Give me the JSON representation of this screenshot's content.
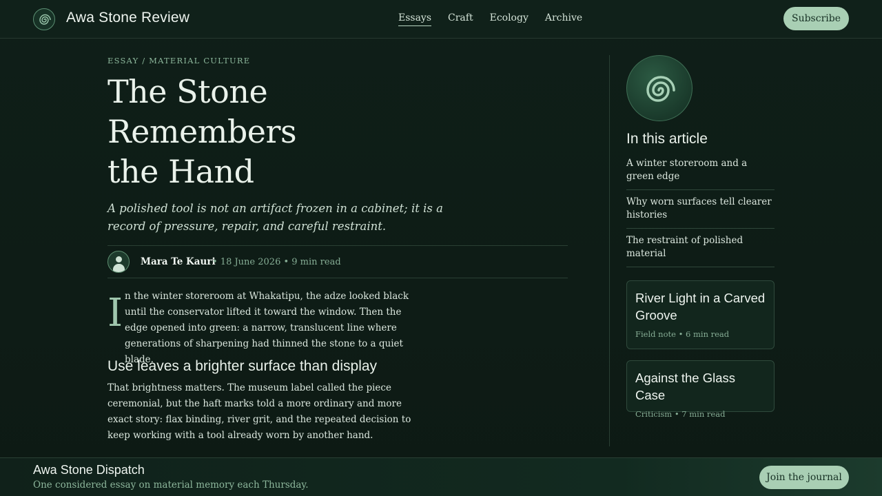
{
  "header": {
    "site_title": "Awa Stone Review",
    "logo_icon": "spiral-icon",
    "nav": [
      {
        "label": "Essays",
        "active": true
      },
      {
        "label": "Craft",
        "active": false
      },
      {
        "label": "Ecology",
        "active": false
      },
      {
        "label": "Archive",
        "active": false
      }
    ],
    "subscribe_label": "Subscribe"
  },
  "article": {
    "kicker": "ESSAY / MATERIAL CULTURE",
    "title_lines": [
      "The Stone",
      "Remembers",
      "the Hand"
    ],
    "dek": "A polished tool is not an artifact frozen in a cabinet; it is a record of pressure, repair, and careful restraint.",
    "author": "Mara Te Kauri",
    "meta": "• 18 June 2026 • 9 min read",
    "dropcap": "I",
    "paragraph1": "n the winter storeroom at Whakatipu, the adze looked black until the conservator lifted it toward the window. Then the edge opened into green: a narrow, translucent line where generations of sharpening had thinned the stone to a quiet blade.",
    "subheading": "Use leaves a brighter surface than display",
    "paragraph2": "That brightness matters. The museum label called the piece ceremonial, but the haft marks told a more ordinary and more exact story: flax binding, river grit, and the repeated decision to keep working with a tool already worn by another hand."
  },
  "sidebar": {
    "toc_title": "In this article",
    "toc": [
      "A winter storeroom and a green edge",
      "Why worn surfaces tell clearer histories",
      "The restraint of polished material"
    ],
    "cards": [
      {
        "title": "River Light in a Carved Groove",
        "meta": "Field note • 6 min read"
      },
      {
        "title": "Against the Glass Case",
        "meta": "Criticism • 7 min read"
      }
    ]
  },
  "footer": {
    "title": "Awa Stone Dispatch",
    "subtitle": "One considered essay on material memory each Thursday.",
    "join_label": "Join the journal"
  },
  "colors": {
    "background": "#0f1f18",
    "accent": "#a9cfb4",
    "muted": "#86ad95"
  }
}
